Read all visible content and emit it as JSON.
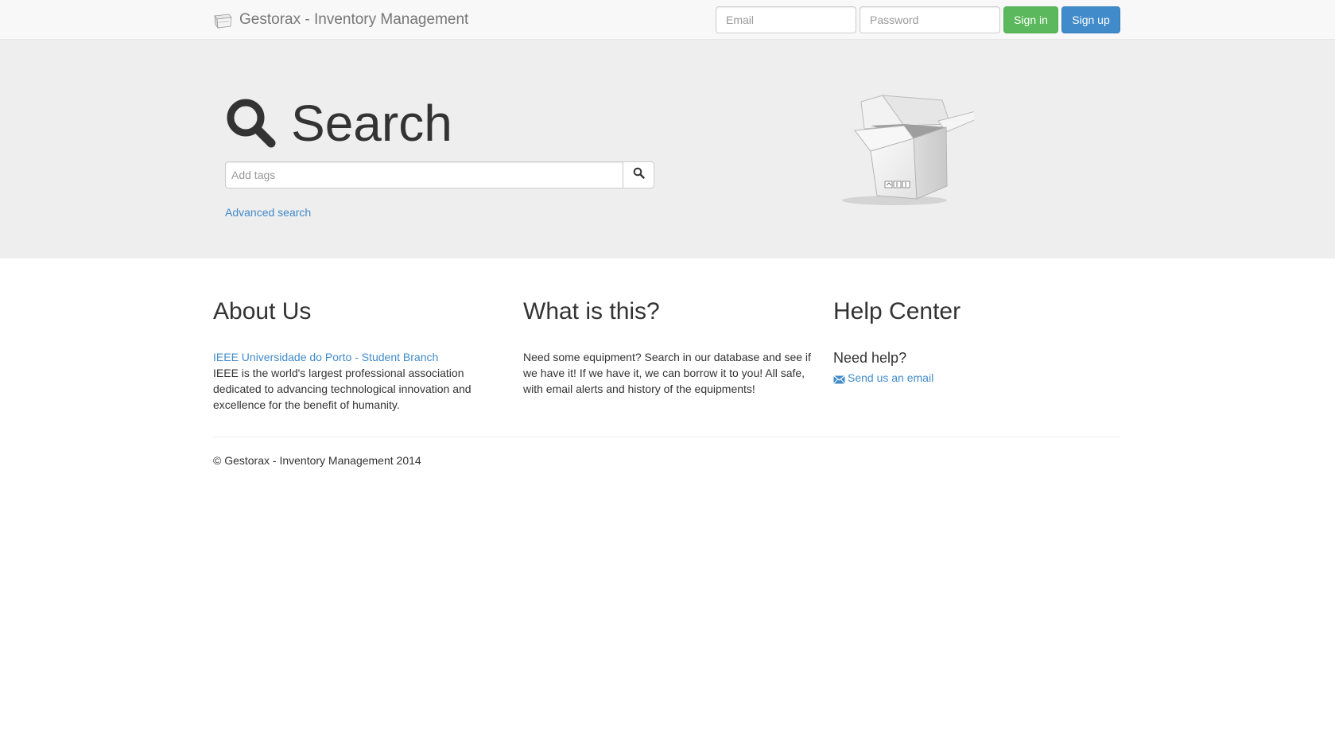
{
  "navbar": {
    "brand_logo_icon": "box-icon",
    "brand": "Gestorax - Inventory Management",
    "email_placeholder": "Email",
    "password_placeholder": "Password",
    "signin_label": "Sign in",
    "signup_label": "Sign up"
  },
  "hero": {
    "title_icon": "magnifier-icon",
    "title": "Search",
    "tags_placeholder": "Add tags",
    "search_button_icon": "search-icon",
    "advanced_link": "Advanced search",
    "illustration": "open-box-icon"
  },
  "about": {
    "heading": "About Us",
    "link": "IEEE Universidade do Porto - Student Branch",
    "text": "IEEE is the world's largest professional association dedicated to advancing technological innovation and excellence for the benefit of humanity."
  },
  "what": {
    "heading": "What is this?",
    "text": "Need some equipment? Search in our database and see if we have it! If we have it, we can borrow it to you! All safe, with email alerts and history of the equipments!"
  },
  "help": {
    "heading": "Help Center",
    "subheading": "Need help?",
    "email_icon": "envelope-icon",
    "email_link": "Send us an email"
  },
  "footer": {
    "text": "© Gestorax - Inventory Management 2014"
  },
  "colors": {
    "link": "#428bca",
    "signin": "#5cb85c",
    "signup": "#428bca",
    "jumbotron": "#eeeeee",
    "navbar": "#f8f8f8"
  }
}
